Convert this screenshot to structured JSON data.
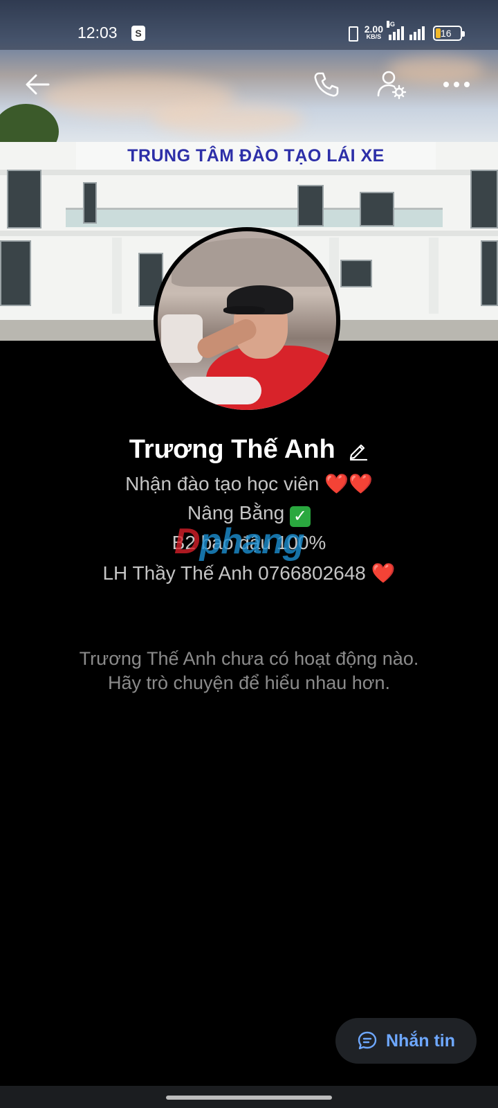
{
  "status_bar": {
    "time": "12:03",
    "shop_icon_letter": "S",
    "net_speed_value": "2.00",
    "net_speed_unit": "KB/S",
    "network_type": "4G",
    "battery_level": "16"
  },
  "cover": {
    "sign_text": "TRUNG TÂM ĐÀO TẠO LÁI XE"
  },
  "profile": {
    "name": "Trương Thế Anh",
    "bio_lines": [
      "Nhận đào tạo học viên",
      "Nâng Bằng",
      "B2 bao đậu 100%",
      "LH Thầy Thế Anh 0766802648"
    ],
    "hearts_line1": "❤️❤️",
    "check_mark": "✓",
    "heart_line4": "❤️"
  },
  "watermark": {
    "part1": "D",
    "part2": "phang"
  },
  "empty_state": {
    "line1": "Trương Thế Anh chưa có hoạt động nào.",
    "line2": "Hãy trò chuyện để hiểu nhau hơn."
  },
  "actions": {
    "message_label": "Nhắn tin"
  },
  "colors": {
    "accent": "#6ea8ff",
    "heart": "#e0222c",
    "check": "#2aa83f"
  }
}
